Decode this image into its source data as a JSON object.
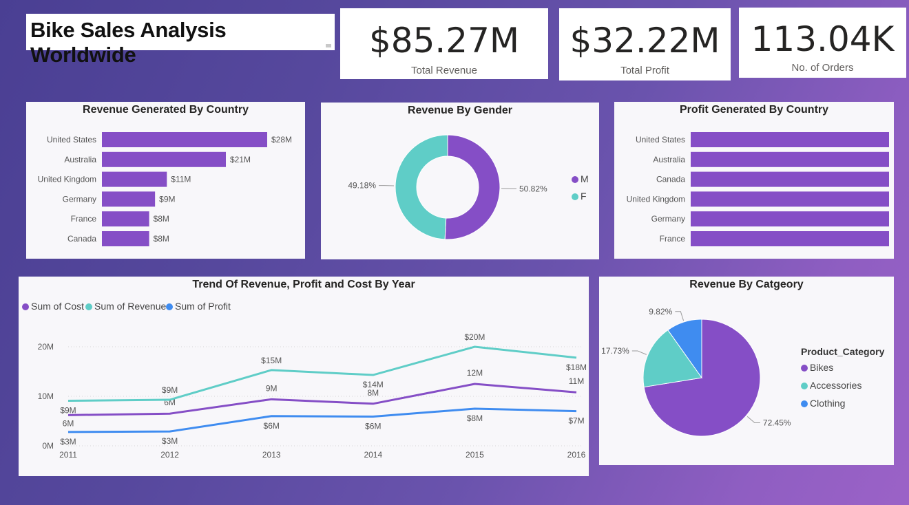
{
  "page_title": "Bike Sales Analysis Worldwide",
  "kpis": [
    {
      "value": "$85.27M",
      "label": "Total Revenue"
    },
    {
      "value": "$32.22M",
      "label": "Total Profit"
    },
    {
      "value": "113.04K",
      "label": "No. of Orders"
    }
  ],
  "colors": {
    "purple": "#854ec6",
    "teal": "#5fcdc7",
    "blue": "#3f8cf0",
    "background": "#5a4aa0"
  },
  "chart_data": [
    {
      "id": "revenue_by_country",
      "type": "bar",
      "orientation": "horizontal",
      "title": "Revenue Generated By Country",
      "categories": [
        "United States",
        "Australia",
        "United Kingdom",
        "Germany",
        "France",
        "Canada"
      ],
      "values": [
        28,
        21,
        11,
        9,
        8,
        8
      ],
      "data_labels": [
        "$28M",
        "$21M",
        "$11M",
        "$9M",
        "$8M",
        "$8M"
      ],
      "xlim": [
        0,
        28
      ]
    },
    {
      "id": "revenue_by_gender",
      "type": "pie",
      "donut": true,
      "title": "Revenue By Gender",
      "categories": [
        "M",
        "F"
      ],
      "values": [
        50.82,
        49.18
      ],
      "data_labels": [
        "50.82%",
        "49.18%"
      ],
      "legend": "right"
    },
    {
      "id": "profit_by_country",
      "type": "bar",
      "orientation": "horizontal",
      "title": "Profit Generated By Country",
      "categories": [
        "United States",
        "Australia",
        "Canada",
        "United Kingdom",
        "Germany",
        "France"
      ],
      "values": [
        1,
        1,
        1,
        1,
        1,
        1
      ],
      "xlim": [
        0,
        1
      ]
    },
    {
      "id": "trend_by_year",
      "type": "line",
      "title": "Trend Of Revenue, Profit and Cost By Year",
      "x": [
        "2011",
        "2012",
        "2013",
        "2014",
        "2015",
        "2016"
      ],
      "ylim": [
        0,
        20
      ],
      "y_ticks": [
        "0M",
        "10M",
        "20M"
      ],
      "grid": true,
      "legend": "top-left",
      "series": [
        {
          "name": "Sum of Cost",
          "values": [
            6.2,
            6.5,
            9.4,
            8.5,
            12.5,
            10.8
          ],
          "labels": [
            "6M",
            "6M",
            "9M",
            "8M",
            "12M",
            "11M"
          ]
        },
        {
          "name": "Sum of Revenue",
          "values": [
            9.1,
            9.3,
            15.3,
            14.3,
            20.0,
            17.8
          ],
          "labels": [
            "$9M",
            "$9M",
            "$15M",
            "$14M",
            "$20M",
            "$18M"
          ]
        },
        {
          "name": "Sum of Profit",
          "values": [
            2.8,
            2.9,
            6.0,
            5.9,
            7.5,
            7.0
          ],
          "labels": [
            "$3M",
            "$3M",
            "$6M",
            "$6M",
            "$8M",
            "$7M"
          ]
        }
      ]
    },
    {
      "id": "revenue_by_category",
      "type": "pie",
      "title": "Revenue By Catgeory",
      "legend_title": "Product_Category",
      "categories": [
        "Bikes",
        "Accessories",
        "Clothing"
      ],
      "values": [
        72.45,
        17.73,
        9.82
      ],
      "data_labels": [
        "72.45%",
        "17.73%",
        "9.82%"
      ],
      "legend": "right"
    }
  ]
}
